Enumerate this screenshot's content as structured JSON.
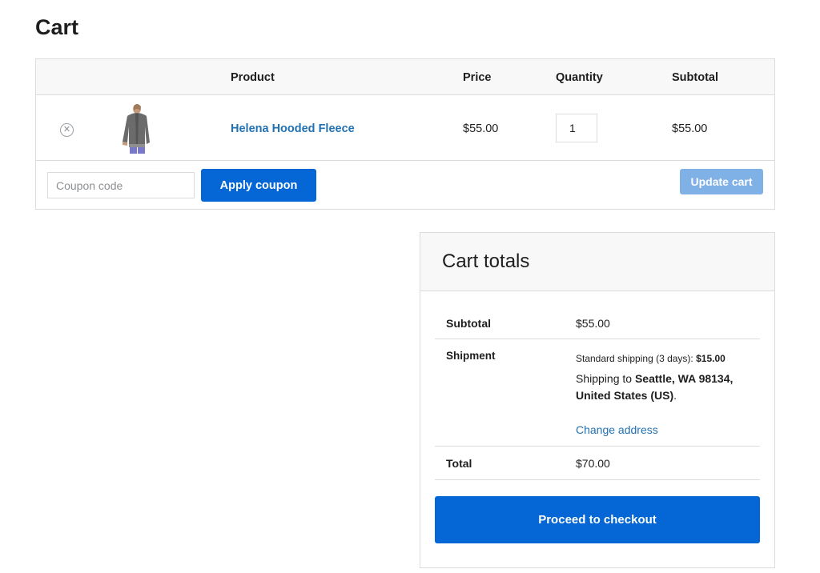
{
  "page": {
    "title": "Cart"
  },
  "cart_table": {
    "headers": {
      "product": "Product",
      "price": "Price",
      "quantity": "Quantity",
      "subtotal": "Subtotal"
    },
    "items": [
      {
        "remove_icon": "close-circle-icon",
        "thumbnail": "hooded-fleece-product-image",
        "name": "Helena Hooded Fleece",
        "price": "$55.00",
        "quantity": "1",
        "subtotal": "$55.00"
      }
    ]
  },
  "coupon": {
    "placeholder": "Coupon code",
    "apply_label": "Apply coupon"
  },
  "update_cart_label": "Update cart",
  "cart_totals": {
    "title": "Cart totals",
    "subtotal_label": "Subtotal",
    "subtotal_value": "$55.00",
    "shipment_label": "Shipment",
    "shipping_method_text": "Standard shipping (3 days): ",
    "shipping_method_price": "$15.00",
    "shipping_to_prefix": "Shipping to ",
    "shipping_destination": "Seattle, WA 98134, United States (US)",
    "shipping_to_suffix": ".",
    "change_address_label": "Change address",
    "total_label": "Total",
    "total_value": "$70.00",
    "checkout_label": "Proceed to checkout"
  },
  "colors": {
    "primary_button": "#0467d5",
    "disabled_button": "#7fb1e6",
    "link": "#2271b1",
    "border": "#dcdcde",
    "header_bg": "#f8f8f8"
  }
}
